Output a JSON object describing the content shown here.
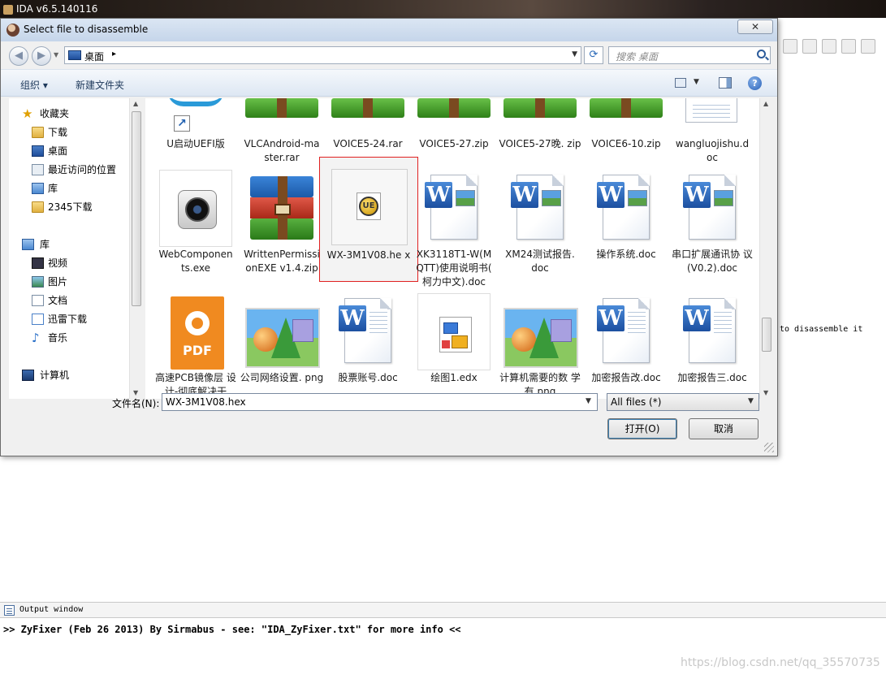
{
  "ida": {
    "title": "IDA v6.5.140116",
    "bg_text": "to disassemble it",
    "output_window_title": "Output window",
    "output_text": ">> ZyFixer (Feb 26 2013) By Sirmabus - see: \"IDA_ZyFixer.txt\" for more info <<",
    "watermark": "https://blog.csdn.net/qq_35570735"
  },
  "dialog": {
    "title": "Select file to disassemble",
    "close_glyph": "✕",
    "address": {
      "location": "桌面",
      "separator": "▸"
    },
    "search": {
      "placeholder": "搜索 桌面"
    },
    "commands": {
      "organize": "组织 ▾",
      "new_folder": "新建文件夹",
      "help": "?"
    },
    "nav": {
      "favorites": "收藏夹",
      "favorites_items": [
        "下载",
        "桌面",
        "最近访问的位置",
        "库",
        "2345下载"
      ],
      "libraries": "库",
      "libraries_items": [
        "视频",
        "图片",
        "文档",
        "迅雷下载",
        "音乐"
      ],
      "computer": "计算机"
    },
    "files": [
      {
        "name": "U启动UEFI版",
        "icon": "shortcut-icon"
      },
      {
        "name": "VLCAndroid-ma ster.rar",
        "icon": "zip-icon"
      },
      {
        "name": "VOICE5-24.rar",
        "icon": "zip-icon"
      },
      {
        "name": "VOICE5-27.zip",
        "icon": "zip-icon"
      },
      {
        "name": "VOICE5-27晚. zip",
        "icon": "zip-icon"
      },
      {
        "name": "VOICE6-10.zip",
        "icon": "zip-icon"
      },
      {
        "name": "wangluojishu.d oc",
        "icon": "word-icon"
      },
      {
        "name": "WebComponen ts.exe",
        "icon": "camera-icon"
      },
      {
        "name": "WrittenPermissi onEXE v1.4.zip",
        "icon": "winrar-icon"
      },
      {
        "name": "WX-3M1V08.he x",
        "icon": "ultraedit-icon",
        "selected": true
      },
      {
        "name": "XK3118T1-W(M QTT)使用说明书( 柯力中文).doc",
        "icon": "word-icon"
      },
      {
        "name": "XM24测试报告. doc",
        "icon": "word-icon"
      },
      {
        "name": "操作系统.doc",
        "icon": "word-icon"
      },
      {
        "name": "串口扩展通讯协 议(V0.2).doc",
        "icon": "word-icon"
      },
      {
        "name": "高速PCB镜像层 设计-彻底解决干",
        "icon": "pdf-icon"
      },
      {
        "name": "公司网络设置. png",
        "icon": "image-icon"
      },
      {
        "name": "股票账号.doc",
        "icon": "word-icon"
      },
      {
        "name": "绘图1.edx",
        "icon": "edx-icon"
      },
      {
        "name": "计算机需要的数 学有.png",
        "icon": "image-icon"
      },
      {
        "name": "加密报告改.doc",
        "icon": "word-icon"
      },
      {
        "name": "加密报告三.doc",
        "icon": "word-icon"
      }
    ],
    "pdf_label": "PDF",
    "filename_label": "文件名(N):",
    "filename_value": "WX-3M1V08.hex",
    "filetype_value": "All files (*)",
    "open_label": "打开(O)",
    "cancel_label": "取消"
  }
}
